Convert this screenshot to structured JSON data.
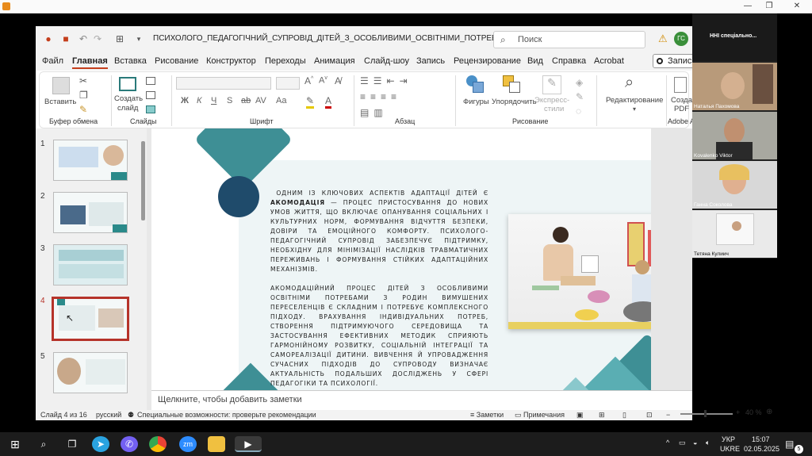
{
  "window": {
    "min": "—",
    "max": "❐",
    "close": "✕"
  },
  "ppt": {
    "title": "ПСИХОЛОГО_ПЕДАГОГІЧНИЙ_СУПРОВІД_ДІТЕЙ_З_ОСОБЛИВИМИ_ОСВІТНІМИ_ПОТРЕБАМИ - Power...",
    "search_placeholder": "Поиск",
    "avatar_initials": "ГС",
    "menus": [
      "Файл",
      "Главная",
      "Вставка",
      "Рисование",
      "Конструктор",
      "Переходы",
      "Анимация",
      "Слайд-шоу",
      "Запись",
      "Рецензирование",
      "Вид",
      "Справка",
      "Acrobat"
    ],
    "record_label": "Запись",
    "ribbon": {
      "paste": "Вставить",
      "create_slide_1": "Создать",
      "create_slide_2": "слайд",
      "g_clipboard": "Буфер обмена",
      "g_slides": "Слайды",
      "g_font": "Шрифт",
      "g_paragraph": "Абзац",
      "g_drawing": "Рисование",
      "g_adobe": "Adobe A",
      "font_btns": [
        "Ж",
        "К",
        "Ч",
        "S",
        "AV",
        "Aa"
      ],
      "shapes": "Фигуры",
      "arrange": "Упорядочить",
      "quick_styles_1": "Экспресс-",
      "quick_styles_2": "стили",
      "editing": "Редактирование",
      "create_pdf_1": "Созда",
      "create_pdf_2": "PDF"
    },
    "thumbs": [
      "1",
      "2",
      "3",
      "4",
      "5"
    ],
    "slide": {
      "p1_text": "ОДНИМ ІЗ КЛЮЧОВИХ АСПЕКТІВ АДАПТАЦІЇ ДІТЕЙ Є",
      "p1_bold": "АКОМОДАЦІЯ",
      "p1_rest": " — ПРОЦЕС ПРИСТОСУВАННЯ ДО НОВИХ УМОВ ЖИТТЯ, ЩО ВКЛЮЧАЄ ОПАНУВАННЯ СОЦІАЛЬНИХ І КУЛЬТУРНИХ НОРМ, ФОРМУВАННЯ ВІДЧУТТЯ БЕЗПЕКИ, ДОВІРИ ТА ЕМОЦІЙНОГО КОМФОРТУ. ПСИХОЛОГО-ПЕДАГОГІЧНИЙ СУПРОВІД ЗАБЕЗПЕЧУЄ ПІДТРИМКУ, НЕОБХІДНУ ДЛЯ МІНІМІЗАЦІЇ НАСЛІДКІВ ТРАВМАТИЧНИХ ПЕРЕЖИВАНЬ І ФОРМУВАННЯ СТІЙКИХ АДАПТАЦІЙНИХ МЕХАНІЗМІВ.",
      "p2": "АКОМОДАЦІЙНИЙ ПРОЦЕС ДІТЕЙ З ОСОБЛИВИМИ ОСВІТНІМИ ПОТРЕБАМИ З РОДИН ВИМУШЕНИХ ПЕРЕСЕЛЕНЦІВ Є СКЛАДНИМ І ПОТРЕБУЄ КОМПЛЕКСНОГО ПІДХОДУ. ВРАХУВАННЯ ІНДИВІДУАЛЬНИХ ПОТРЕБ, СТВОРЕННЯ ПІДТРИМУЮЧОГО СЕРЕДОВИЩА ТА ЗАСТОСУВАННЯ ЕФЕКТИВНИХ МЕТОДИК СПРИЯЮТЬ ГАРМОНІЙНОМУ РОЗВИТКУ, СОЦІАЛЬНІЙ ІНТЕГРАЦІЇ ТА САМОРЕАЛІЗАЦІЇ ДИТИНИ. ВИВЧЕННЯ Й УПРОВАДЖЕННЯ СУЧАСНИХ ПІДХОДІВ ДО СУПРОВОДУ ВИЗНАЧАЄ АКТУАЛЬНІСТЬ ПОДАЛЬШИХ ДОСЛІДЖЕНЬ У СФЕРІ ПЕДАГОГІКИ ТА ПСИХОЛОГІЇ."
    },
    "notes_placeholder": "Щелкните, чтобы добавить заметки",
    "status": {
      "slide": "Слайд 4 из 16",
      "lang": "русский",
      "accessibility": "Специальные возможности: проверьте рекомендации",
      "notes": "Заметки",
      "comments": "Примечания",
      "zoom": "40 %",
      "minus": "−",
      "plus": "+"
    }
  },
  "conference": {
    "header": "ННІ спеціально...",
    "participants": [
      "Наталья Пахомова",
      "Kovalenko Viktor",
      "Ганна Соколова",
      "Тетяна Кулиич"
    ]
  },
  "taskbar": {
    "lang1": "УКР",
    "lang2": "UKRE",
    "time": "15:07",
    "date": "02.05.2025",
    "notif": "5"
  }
}
